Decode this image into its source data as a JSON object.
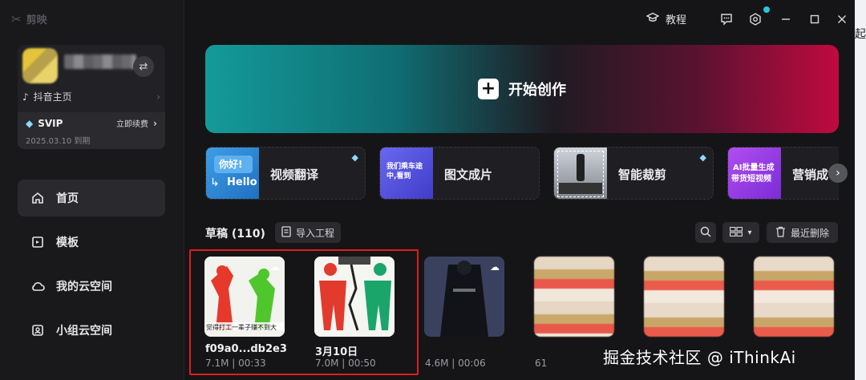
{
  "app": {
    "title": "剪映"
  },
  "topbar": {
    "tutorial_label": "教程"
  },
  "profile": {
    "douyin_label": "抖音主页",
    "vip_label": "SVIP",
    "renew_label": "立即续费",
    "vip_expiry": "2025.03.10 到期"
  },
  "sidebar": {
    "items": [
      {
        "label": "首页",
        "icon": "home-icon",
        "active": true
      },
      {
        "label": "模板",
        "icon": "template-icon",
        "active": false
      },
      {
        "label": "我的云空间",
        "icon": "cloud-icon",
        "active": false
      },
      {
        "label": "小组云空间",
        "icon": "group-cloud-icon",
        "active": false
      }
    ]
  },
  "banner": {
    "label": "开始创作"
  },
  "features": [
    {
      "label": "视频翻译",
      "thumb_line1": "你好!",
      "thumb_line2": "Hello",
      "vip": true
    },
    {
      "label": "图文成片",
      "thumb_text": "我们乘车途中,看到",
      "vip": false
    },
    {
      "label": "智能裁剪",
      "vip": true
    },
    {
      "label": "营销成",
      "thumb_line1": "AI批量生成",
      "thumb_line2": "带货短视频",
      "vip": false
    }
  ],
  "drafts": {
    "title": "草稿 (110)",
    "import_label": "导入工程",
    "recent_delete_label": "最近删除",
    "items": [
      {
        "name": "f09a0...db2e3",
        "meta": "7.1M | 00:33",
        "caption": "觉得打工一辈子赚不到大"
      },
      {
        "name": "3月10日",
        "meta": "7.0M | 00:50"
      },
      {
        "name": "",
        "meta": "4.6M | 00:06"
      },
      {
        "name": "",
        "meta": "61"
      }
    ]
  },
  "watermark": "掘金技术社区 @ iThinkAi",
  "colors": {
    "highlight": "#e01d1d",
    "accent_teal": "#149a9a",
    "accent_red": "#c00a40"
  }
}
